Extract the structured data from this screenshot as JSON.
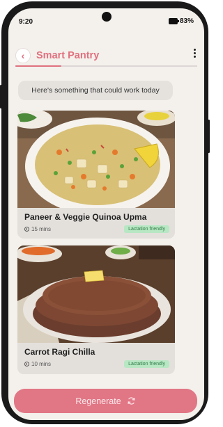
{
  "status_bar": {
    "time": "9:20",
    "battery": "83%"
  },
  "header": {
    "title": "Smart Pantry",
    "back_icon": "chevron-left-icon",
    "menu_icon": "kebab-menu-icon"
  },
  "message": "Here's something that could work today",
  "recipes": [
    {
      "title": "Paneer & Veggie Quinoa Upma",
      "time": "15 mins",
      "badge": "Lactation friendly",
      "image": "quinoa-upma-bowl"
    },
    {
      "title": "Carrot Ragi Chilla",
      "time": "10 mins",
      "badge": "Lactation friendly",
      "image": "ragi-chilla-stack"
    }
  ],
  "actions": {
    "regenerate_label": "Regenerate",
    "regenerate_icon": "refresh-icon"
  },
  "colors": {
    "accent": "#e0707f",
    "badge_bg": "#b8e7c4",
    "badge_text": "#2e7b45",
    "background": "#f4f1ec"
  }
}
